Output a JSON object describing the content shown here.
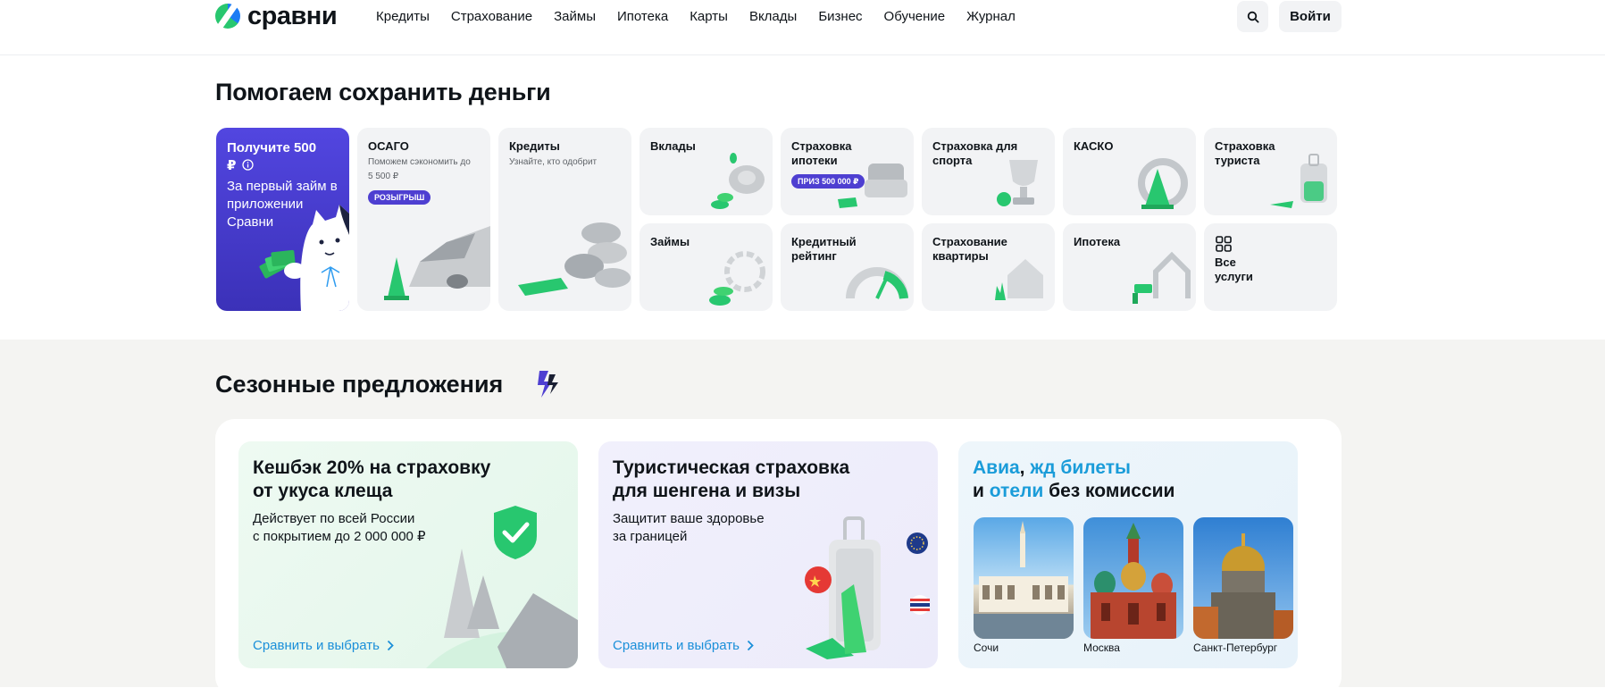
{
  "header": {
    "logo_text": "сравни",
    "nav": [
      "Кредиты",
      "Страхование",
      "Займы",
      "Ипотека",
      "Карты",
      "Вклады",
      "Бизнес",
      "Обучение",
      "Журнал"
    ],
    "login_label": "Войти"
  },
  "services": {
    "title": "Помогаем сохранить деньги",
    "promo": {
      "title": "Получите 500 ₽",
      "text": "За первый займ в приложении Сравни"
    },
    "osago": {
      "title": "ОСАГО",
      "sub": "Поможем сэкономить до 5 500 ₽",
      "badge": "РОЗЫГРЫШ"
    },
    "credits": {
      "title": "Кредиты",
      "sub": "Узнайте, кто одобрит"
    },
    "vklady": {
      "title": "Вклады"
    },
    "mortgage_ins": {
      "title": "Страховка ипотеки",
      "badge": "ПРИЗ 500 000 ₽"
    },
    "sport_ins": {
      "title": "Страховка для спорта"
    },
    "kasko": {
      "title": "КАСКО"
    },
    "tourist_ins": {
      "title": "Страховка туриста"
    },
    "loans": {
      "title": "Займы"
    },
    "credit_rating": {
      "title": "Кредитный рейтинг"
    },
    "flat_ins": {
      "title": "Страхование квартиры"
    },
    "mortgage": {
      "title": "Ипотека"
    },
    "all": {
      "title": "Все услуги"
    }
  },
  "seasonal": {
    "title": "Сезонные предложения",
    "cards": [
      {
        "title_line1": "Кешбэк 20% на страховку",
        "title_line2": "от укуса клеща",
        "sub_line1": "Действует по всей России",
        "sub_line2": "с покрытием до 2 000 000 ₽",
        "link": "Сравнить и выбрать"
      },
      {
        "title_line1": "Туристическая страховка",
        "title_line2": "для шенгена и визы",
        "sub_line1": "Защитит ваше здоровье",
        "sub_line2": "за границей",
        "link": "Сравнить и выбрать"
      },
      {
        "title_part1": "Авиа",
        "title_part2": ", ",
        "title_part3": "жд билеты",
        "title_part4": "и ",
        "title_part5": "отели",
        "title_part6": " без комиссии",
        "cities": [
          "Сочи",
          "Москва",
          "Санкт-Петербург"
        ]
      }
    ]
  },
  "colors": {
    "brand_purple": "#4e3fd1",
    "brand_green": "#28c76f",
    "link_blue": "#1a8fd9"
  }
}
